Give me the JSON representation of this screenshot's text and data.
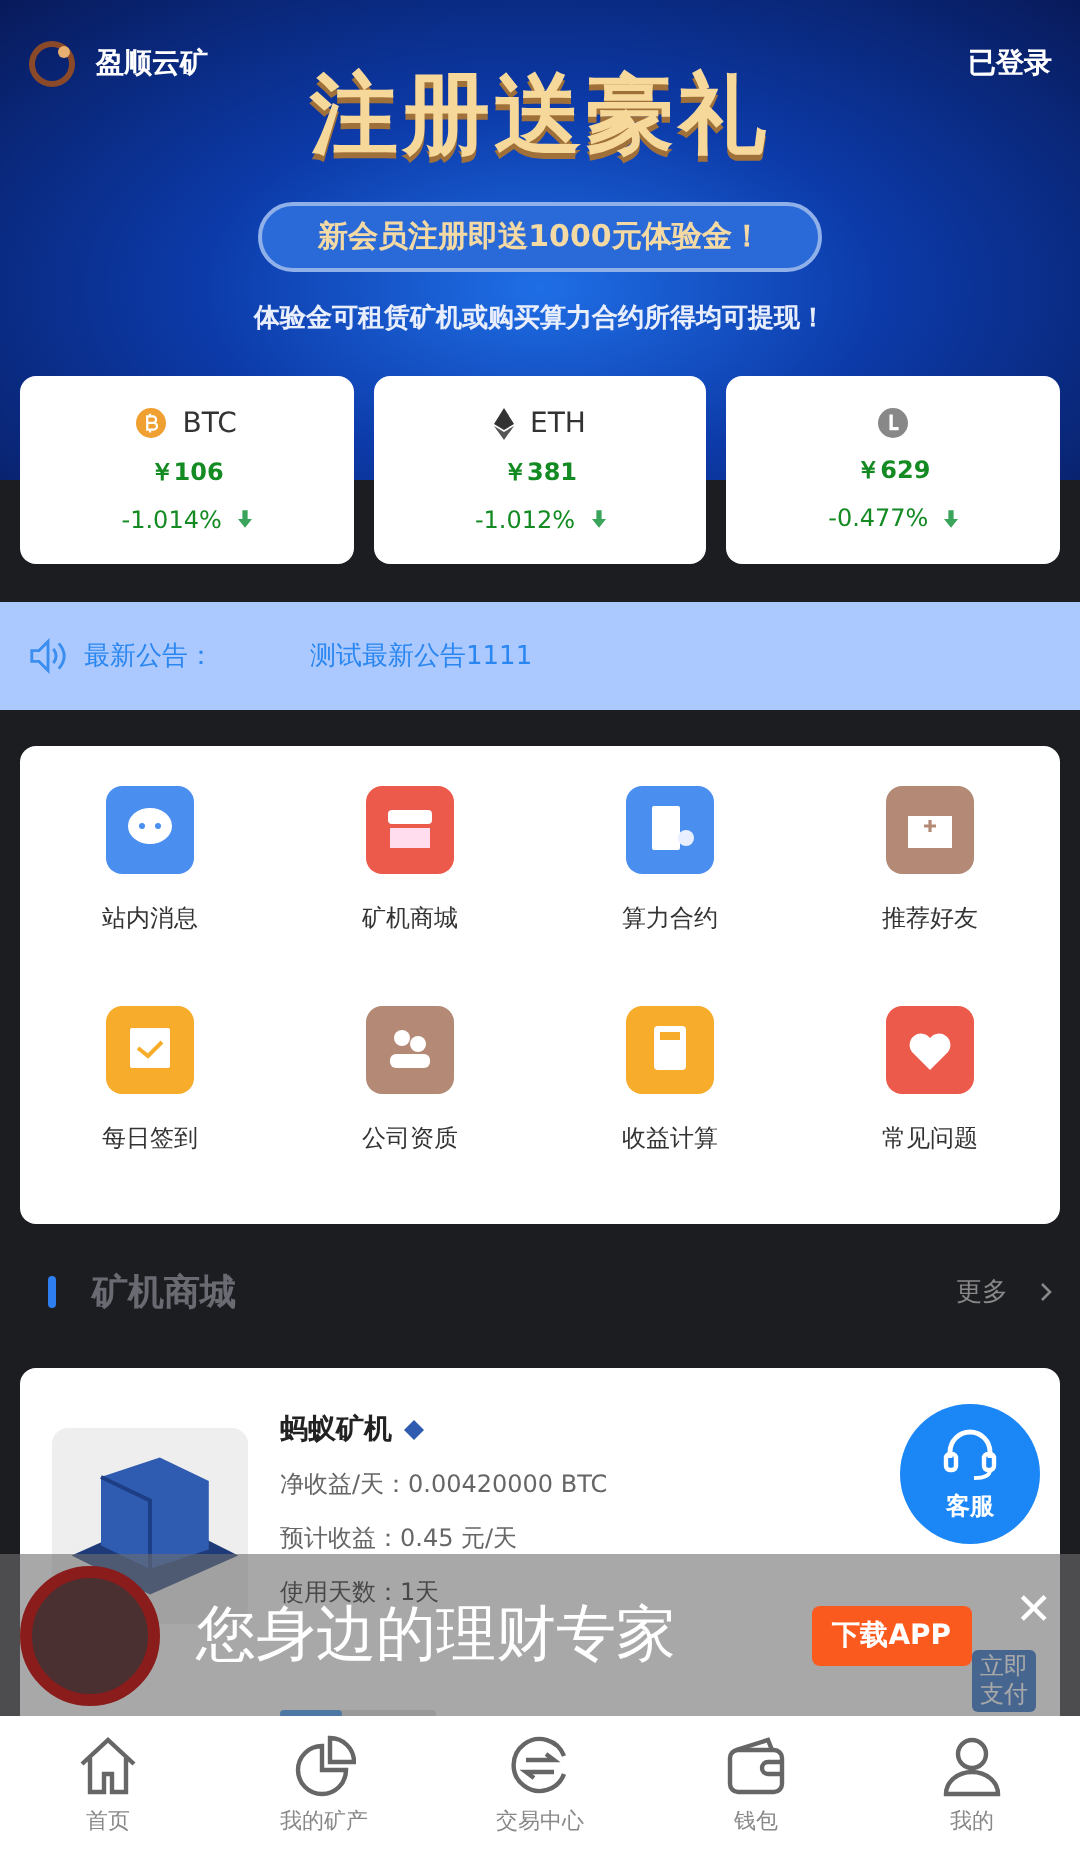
{
  "header": {
    "brand": "盈顺云矿",
    "login": "已登录"
  },
  "banner": {
    "title": "注册送豪礼",
    "ribbon": "新会员注册即送1000元体验金！",
    "subtitle": "体验金可租赁矿机或购买算力合约所得均可提现！"
  },
  "tickers": [
    {
      "kind": "btc",
      "name": "BTC",
      "price": "￥106",
      "change": "-1.014%"
    },
    {
      "kind": "eth",
      "name": "ETH",
      "price": "￥381",
      "change": "-1.012%"
    },
    {
      "kind": "ltc",
      "price": "￥629",
      "change": "-0.477%"
    }
  ],
  "notice": {
    "label": "最新公告：",
    "text": "测试最新公告1111"
  },
  "shortcuts": [
    {
      "kind": "chat",
      "label": "站内消息",
      "color": "#4a8ff0"
    },
    {
      "kind": "shop",
      "label": "矿机商城",
      "color": "#ec5a4c"
    },
    {
      "kind": "contract",
      "label": "算力合约",
      "color": "#4a8ff0"
    },
    {
      "kind": "mail",
      "label": "推荐好友",
      "color": "#b48a76"
    },
    {
      "kind": "calendar",
      "label": "每日签到",
      "color": "#f8ac2c"
    },
    {
      "kind": "people",
      "label": "公司资质",
      "color": "#b48a76"
    },
    {
      "kind": "calc",
      "label": "收益计算",
      "color": "#f8ac2c"
    },
    {
      "kind": "heart",
      "label": "常见问题",
      "color": "#ec5a4c"
    }
  ],
  "section": {
    "title": "矿机商城",
    "more": "更多"
  },
  "product": {
    "name": "蚂蚁矿机",
    "lines": [
      "净收益/天：0.00420000 BTC",
      "预计收益：0.45 元/天",
      "使用天数：1天"
    ],
    "level": 0.4,
    "pay": "立即支付"
  },
  "service": {
    "label": "客服"
  },
  "promo": {
    "slogan": "您身边的理财专家",
    "download": "下载APP",
    "close": "✕"
  },
  "tabbar": [
    {
      "kind": "home",
      "label": "首页",
      "selected": false
    },
    {
      "kind": "pie",
      "label": "我的矿产",
      "selected": false
    },
    {
      "kind": "exchange",
      "label": "交易中心",
      "selected": false
    },
    {
      "kind": "wallet",
      "label": "钱包",
      "selected": false
    },
    {
      "kind": "user",
      "label": "我的",
      "selected": false
    }
  ]
}
